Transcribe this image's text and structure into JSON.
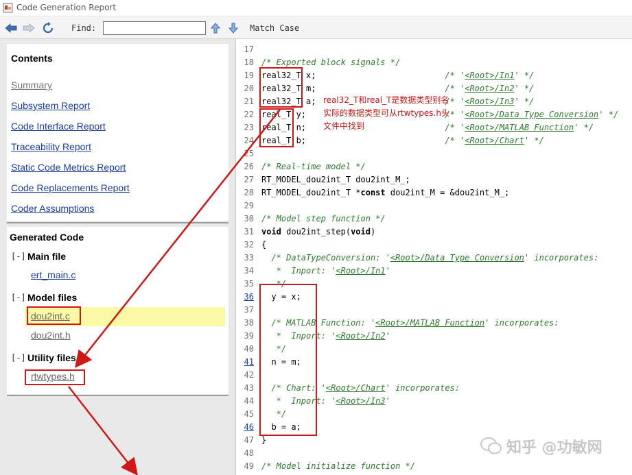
{
  "window": {
    "title": "Code Generation Report"
  },
  "toolbar": {
    "find_label": "Find:",
    "find_value": "",
    "match_case_label": "Match Case",
    "icons": [
      "back-arrow-icon",
      "forward-arrow-icon",
      "refresh-icon",
      "find-up-icon",
      "find-down-icon"
    ]
  },
  "contents": {
    "heading": "Contents",
    "links": [
      {
        "label": "Summary",
        "visited": true
      },
      {
        "label": "Subsystem Report",
        "visited": false
      },
      {
        "label": "Code Interface Report",
        "visited": false
      },
      {
        "label": "Traceability Report",
        "visited": false
      },
      {
        "label": "Static Code Metrics Report",
        "visited": false
      },
      {
        "label": "Code Replacements Report",
        "visited": false
      },
      {
        "label": "Coder Assumptions",
        "visited": false
      }
    ]
  },
  "generated_code": {
    "heading": "Generated Code",
    "groups": [
      {
        "toggle": "[-]",
        "label": "Main file",
        "files": [
          "ert_main.c"
        ]
      },
      {
        "toggle": "[-]",
        "label": "Model files",
        "files": [
          "dou2int.c",
          "dou2int.h"
        ]
      },
      {
        "toggle": "[-]",
        "label": "Utility files",
        "files": [
          "rtwtypes.h"
        ]
      }
    ],
    "selected_file": "dou2int.c"
  },
  "code_lines": [
    {
      "n": "17",
      "linked": false,
      "parts": []
    },
    {
      "n": "18",
      "linked": false,
      "parts": [
        [
          "cm",
          "/* Exported block signals */"
        ]
      ]
    },
    {
      "n": "19",
      "linked": false,
      "parts": [
        [
          "t",
          "real32_T x;                          "
        ],
        [
          "cm",
          "/* '"
        ],
        [
          "lnk",
          "<Root>/In1"
        ],
        [
          "cm",
          "' */"
        ]
      ]
    },
    {
      "n": "20",
      "linked": false,
      "parts": [
        [
          "t",
          "real32_T m;                          "
        ],
        [
          "cm",
          "/* '"
        ],
        [
          "lnk",
          "<Root>/In2"
        ],
        [
          "cm",
          "' */"
        ]
      ]
    },
    {
      "n": "21",
      "linked": false,
      "parts": [
        [
          "t",
          "real32_T a;                          "
        ],
        [
          "cm",
          "/* '"
        ],
        [
          "lnk",
          "<Root>/In3"
        ],
        [
          "cm",
          "' */"
        ]
      ]
    },
    {
      "n": "22",
      "linked": false,
      "parts": [
        [
          "t",
          "real_T y;                            "
        ],
        [
          "cm",
          "/* '"
        ],
        [
          "lnk",
          "<Root>/Data Type Conversion"
        ],
        [
          "cm",
          "' */"
        ]
      ]
    },
    {
      "n": "23",
      "linked": false,
      "parts": [
        [
          "t",
          "real_T n;                            "
        ],
        [
          "cm",
          "/* '"
        ],
        [
          "lnk",
          "<Root>/MATLAB Function"
        ],
        [
          "cm",
          "' */"
        ]
      ]
    },
    {
      "n": "24",
      "linked": false,
      "parts": [
        [
          "t",
          "real_T b;                            "
        ],
        [
          "cm",
          "/* '"
        ],
        [
          "lnk",
          "<Root>/Chart"
        ],
        [
          "cm",
          "' */"
        ]
      ]
    },
    {
      "n": "25",
      "linked": false,
      "parts": []
    },
    {
      "n": "26",
      "linked": false,
      "parts": [
        [
          "cm",
          "/* Real-time model */"
        ]
      ]
    },
    {
      "n": "27",
      "linked": false,
      "parts": [
        [
          "t",
          "RT_MODEL_dou2int_T dou2int_M_;"
        ]
      ]
    },
    {
      "n": "28",
      "linked": false,
      "parts": [
        [
          "t",
          "RT_MODEL_dou2int_T *"
        ],
        [
          "kw",
          "const"
        ],
        [
          "t",
          " dou2int_M = &dou2int_M_;"
        ]
      ]
    },
    {
      "n": "29",
      "linked": false,
      "parts": []
    },
    {
      "n": "30",
      "linked": false,
      "parts": [
        [
          "cm",
          "/* Model step function */"
        ]
      ]
    },
    {
      "n": "31",
      "linked": false,
      "parts": [
        [
          "kw",
          "void"
        ],
        [
          "t",
          " dou2int_step("
        ],
        [
          "kw",
          "void"
        ],
        [
          "t",
          ")"
        ]
      ]
    },
    {
      "n": "32",
      "linked": false,
      "parts": [
        [
          "t",
          "{"
        ]
      ]
    },
    {
      "n": "33",
      "linked": false,
      "parts": [
        [
          "cm",
          "  /* DataTypeConversion: '"
        ],
        [
          "lnk",
          "<Root>/Data Type Conversion"
        ],
        [
          "cm",
          "' incorporates:"
        ]
      ]
    },
    {
      "n": "34",
      "linked": false,
      "parts": [
        [
          "cm",
          "   *  Inport: '"
        ],
        [
          "lnk",
          "<Root>/In1"
        ],
        [
          "cm",
          "'"
        ]
      ]
    },
    {
      "n": "35",
      "linked": false,
      "parts": [
        [
          "cm",
          "   */"
        ]
      ]
    },
    {
      "n": "36",
      "linked": true,
      "parts": [
        [
          "t",
          "  y = x;"
        ]
      ]
    },
    {
      "n": "37",
      "linked": false,
      "parts": []
    },
    {
      "n": "38",
      "linked": false,
      "parts": [
        [
          "cm",
          "  /* MATLAB Function: '"
        ],
        [
          "lnk",
          "<Root>/MATLAB Function"
        ],
        [
          "cm",
          "' incorporates:"
        ]
      ]
    },
    {
      "n": "39",
      "linked": false,
      "parts": [
        [
          "cm",
          "   *  Inport: '"
        ],
        [
          "lnk",
          "<Root>/In2"
        ],
        [
          "cm",
          "'"
        ]
      ]
    },
    {
      "n": "40",
      "linked": false,
      "parts": [
        [
          "cm",
          "   */"
        ]
      ]
    },
    {
      "n": "41",
      "linked": true,
      "parts": [
        [
          "t",
          "  n = m;"
        ]
      ]
    },
    {
      "n": "42",
      "linked": false,
      "parts": []
    },
    {
      "n": "43",
      "linked": false,
      "parts": [
        [
          "cm",
          "  /* Chart: '"
        ],
        [
          "lnk",
          "<Root>/Chart"
        ],
        [
          "cm",
          "' incorporates:"
        ]
      ]
    },
    {
      "n": "44",
      "linked": false,
      "parts": [
        [
          "cm",
          "   *  Inport: '"
        ],
        [
          "lnk",
          "<Root>/In3"
        ],
        [
          "cm",
          "'"
        ]
      ]
    },
    {
      "n": "45",
      "linked": false,
      "parts": [
        [
          "cm",
          "   */"
        ]
      ]
    },
    {
      "n": "46",
      "linked": true,
      "parts": [
        [
          "t",
          "  b = a;"
        ]
      ]
    },
    {
      "n": "47",
      "linked": false,
      "parts": [
        [
          "t",
          "}"
        ]
      ]
    },
    {
      "n": "48",
      "linked": false,
      "parts": []
    },
    {
      "n": "49",
      "linked": false,
      "parts": [
        [
          "cm",
          "/* Model initialize function */"
        ]
      ]
    }
  ],
  "annotation": {
    "lines": [
      "real32_T和real_T是数据类型别名",
      "实际的数据类型可从rtwtypes.h头",
      "文件中找到"
    ]
  },
  "watermark": {
    "text": "知乎 @功敏网"
  },
  "colors": {
    "annotation_red": "#d01818",
    "link_blue": "#1a3c9c",
    "comment_green": "#2e7a2e",
    "highlight_yellow": "#fbf8a6"
  }
}
